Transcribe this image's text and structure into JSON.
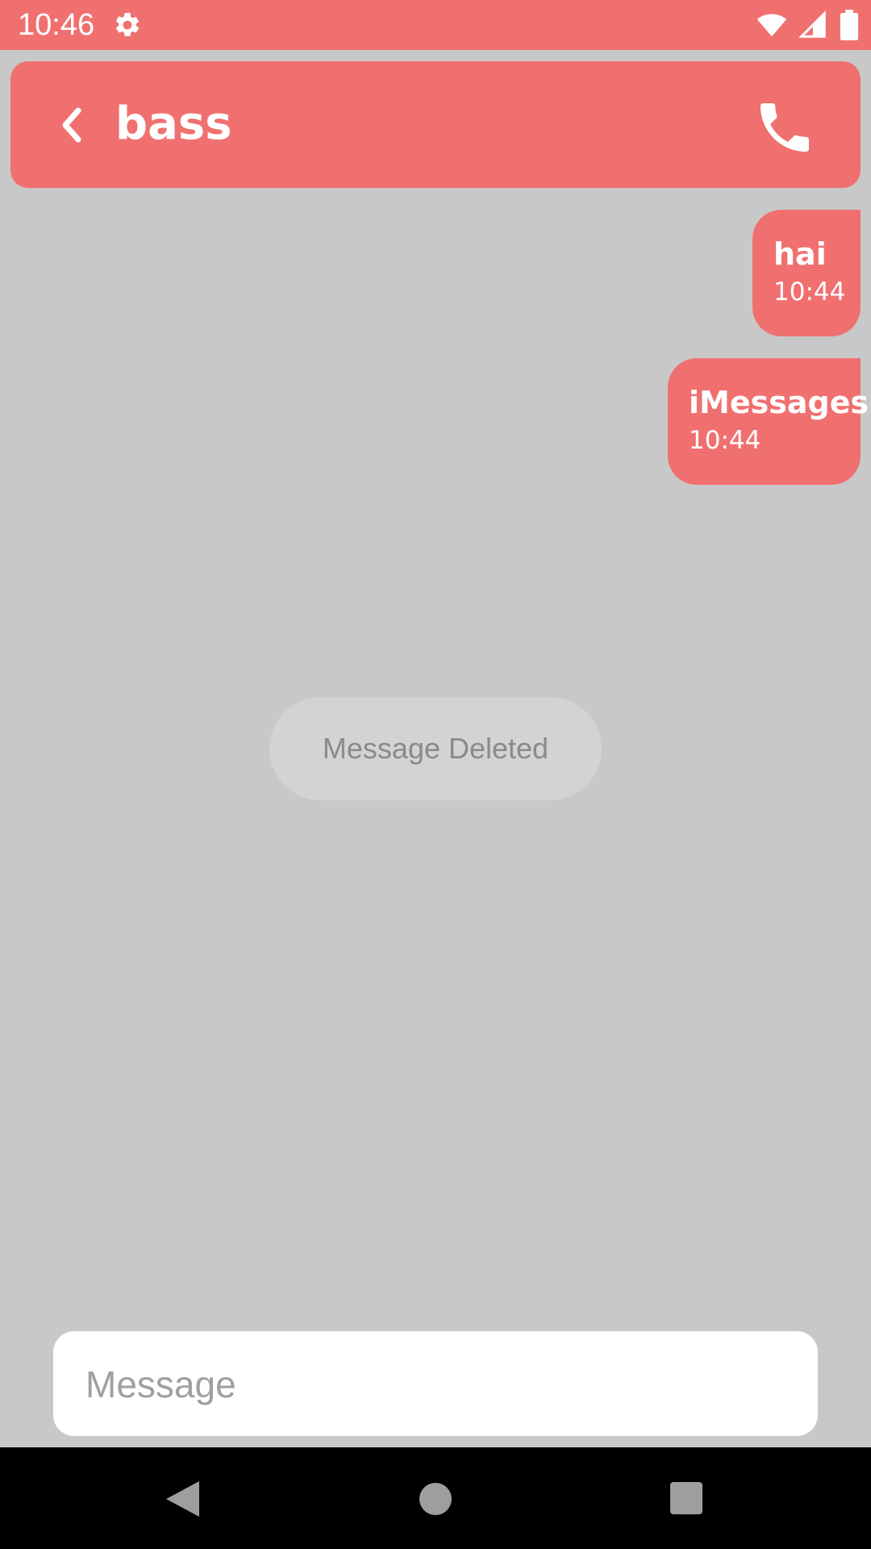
{
  "status_bar": {
    "time": "10:46",
    "icons": [
      "gear-icon",
      "wifi-icon",
      "cell-signal-icon",
      "battery-icon"
    ],
    "background": "#f07070"
  },
  "toolbar": {
    "back_icon": "chevron-left-icon",
    "title": "bass",
    "call_icon": "phone-icon",
    "background": "#f07070"
  },
  "messages": [
    {
      "text": "hai",
      "time": "10:44",
      "direction": "outgoing"
    },
    {
      "text": "iMessages",
      "time": "10:44",
      "direction": "outgoing"
    }
  ],
  "toast": {
    "text": "Message Deleted"
  },
  "composer": {
    "placeholder": "Message",
    "value": ""
  },
  "nav_bar": {
    "icons": [
      "nav-back-icon",
      "nav-home-icon",
      "nav-recents-icon"
    ]
  },
  "colors": {
    "accent": "#f07070",
    "chat_background": "#c8c8c8",
    "toast_background": "#d3d3d3",
    "toast_text": "#8a8a8a"
  }
}
